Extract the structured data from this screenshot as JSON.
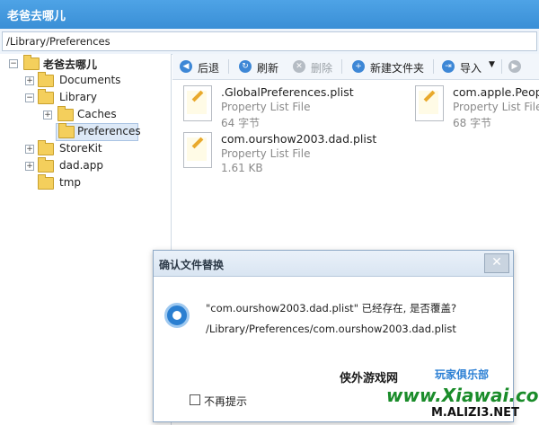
{
  "window": {
    "title": "老爸去哪儿"
  },
  "pathbar": {
    "value": "/Library/Preferences"
  },
  "tree": {
    "items": [
      {
        "label": "老爸去哪儿",
        "expander": "−"
      },
      {
        "label": "Documents",
        "expander": "+"
      },
      {
        "label": "Library",
        "expander": "−"
      },
      {
        "label": "Caches",
        "expander": "+"
      },
      {
        "label": "Preferences",
        "expander": ""
      },
      {
        "label": "StoreKit",
        "expander": "+"
      },
      {
        "label": "dad.app",
        "expander": "+"
      },
      {
        "label": "tmp",
        "expander": ""
      }
    ],
    "selected": "Preferences"
  },
  "toolbar": {
    "back_label": "后退",
    "refresh_label": "刷新",
    "delete_label": "删除",
    "new_folder_label": "新建文件夹",
    "import_label": "导入"
  },
  "files": [
    {
      "name": ".GlobalPreferences.plist",
      "type": "Property List File",
      "size": "64 字节"
    },
    {
      "name": "com.apple.People",
      "type": "Property List File",
      "size": "68 字节"
    },
    {
      "name": "com.ourshow2003.dad.plist",
      "type": "Property List File",
      "size": "1.61 KB"
    }
  ],
  "dialog": {
    "title": "确认文件替换",
    "close_glyph": "✕",
    "message": "\"com.ourshow2003.dad.plist\" 已经存在, 是否覆盖?",
    "path": "/Library/Preferences/com.ourshow2003.dad.plist",
    "checkbox_label": "不再提示",
    "checkbox_checked": false
  },
  "watermark": {
    "site_cn": "侠外游戏网",
    "site_en": "www.Xiawai.com",
    "club": "玩家俱乐部",
    "corner": "M.ALIZI3.NET"
  },
  "colors": {
    "titlebar": "#3a8fd6",
    "accent_icon": "#3d87d6"
  }
}
